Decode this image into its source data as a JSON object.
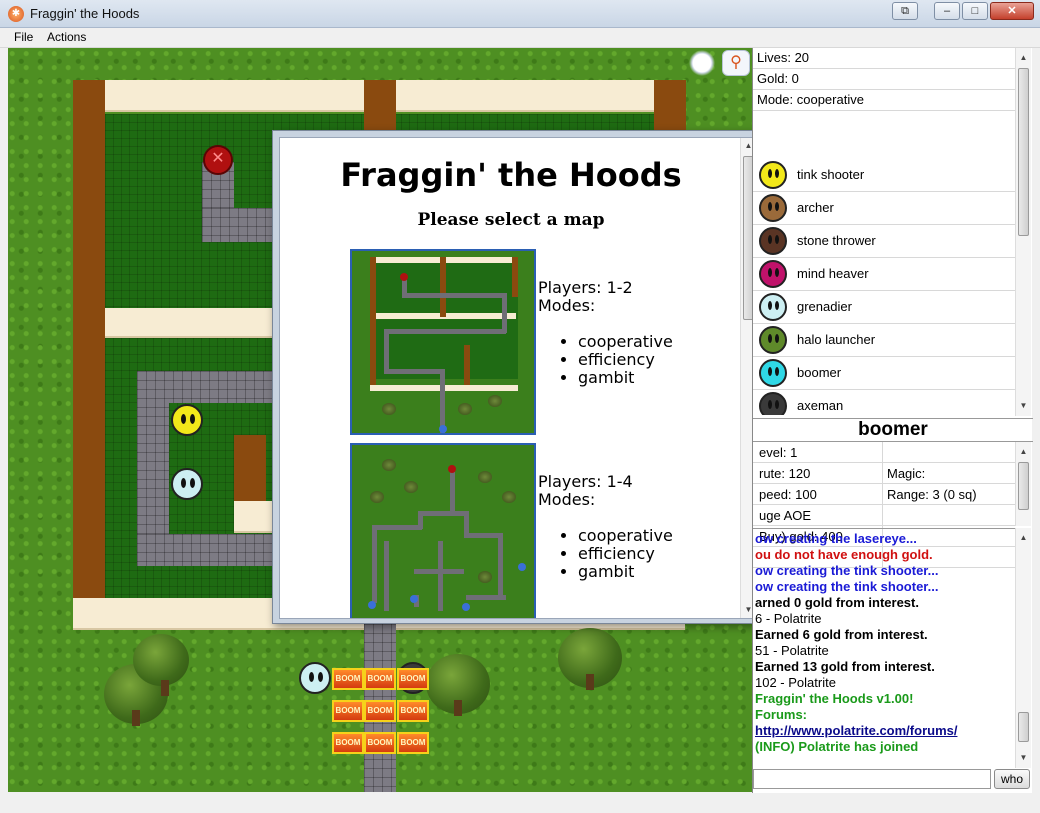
{
  "window": {
    "title": "Fraggin' the Hoods"
  },
  "menu": {
    "items": [
      {
        "label": "File"
      },
      {
        "label": "Actions"
      }
    ]
  },
  "dialog": {
    "title": "Fraggin' the Hoods",
    "subtitle": "Please select a map",
    "maps": [
      {
        "players": "Players: 1-2",
        "modes_label": "Modes:",
        "modes": [
          "cooperative",
          "efficiency",
          "gambit"
        ]
      },
      {
        "players": "Players: 1-4",
        "modes_label": "Modes:",
        "modes": [
          "cooperative",
          "efficiency",
          "gambit"
        ]
      }
    ]
  },
  "stats": {
    "lives": "Lives: 20",
    "gold": "Gold: 0",
    "mode": "Mode: cooperative"
  },
  "towers": [
    {
      "name": "tink shooter",
      "color": "#f2e81a"
    },
    {
      "name": "archer",
      "color": "#9a6a3a"
    },
    {
      "name": "stone thrower",
      "color": "#5a3424"
    },
    {
      "name": "mind heaver",
      "color": "#c0126a"
    },
    {
      "name": "grenadier",
      "color": "#cdeff2"
    },
    {
      "name": "halo launcher",
      "color": "#5f8a2a"
    },
    {
      "name": "boomer",
      "color": "#2fd8e6"
    },
    {
      "name": "axeman",
      "color": "#3a3a3a"
    }
  ],
  "selected": {
    "name": "boomer",
    "rows": [
      {
        "a": "evel: 1",
        "b": ""
      },
      {
        "a": "rute: 120",
        "b": "Magic:"
      },
      {
        "a": "peed: 100",
        "b": "Range: 3 (0 sq)"
      },
      {
        "a": "uge AOE",
        "b": ""
      },
      {
        "a": "Buy) gold: 400",
        "b": ""
      },
      {
        "a": "",
        "b": ""
      }
    ]
  },
  "log": [
    {
      "text": "ow creating the lasereye...",
      "color": "#1a1ad6",
      "bold": true
    },
    {
      "text": "ou do not have enough gold.",
      "color": "#d01010",
      "bold": true
    },
    {
      "text": "ow creating the tink shooter...",
      "color": "#1a1ad6",
      "bold": true
    },
    {
      "text": "ow creating the tink shooter...",
      "color": "#1a1ad6",
      "bold": true
    },
    {
      "text": "arned 0 gold from interest.",
      "color": "#000000",
      "bold": true
    },
    {
      "text": "6 - Polatrite",
      "color": "#000000",
      "bold": false
    },
    {
      "text": "Earned 6 gold from interest.",
      "color": "#000000",
      "bold": true
    },
    {
      "text": "51 - Polatrite",
      "color": "#000000",
      "bold": false
    },
    {
      "text": "Earned 13 gold from interest.",
      "color": "#000000",
      "bold": true
    },
    {
      "text": "102 - Polatrite",
      "color": "#000000",
      "bold": false
    },
    {
      "text": "Fraggin' the Hoods  v1.00!",
      "color": "#1a9a1a",
      "bold": true
    },
    {
      "text": "Forums:",
      "color": "#1a9a1a",
      "bold": true
    },
    {
      "text": "http://www.polatrite.com/forums/",
      "color": "#0a0a8a",
      "bold": true,
      "link": true
    },
    {
      "text": "(INFO) Polatrite has joined",
      "color": "#1a9a1a",
      "bold": true
    }
  ],
  "chat": {
    "who_label": "who"
  },
  "units": {
    "boom_label": "BOOM"
  }
}
